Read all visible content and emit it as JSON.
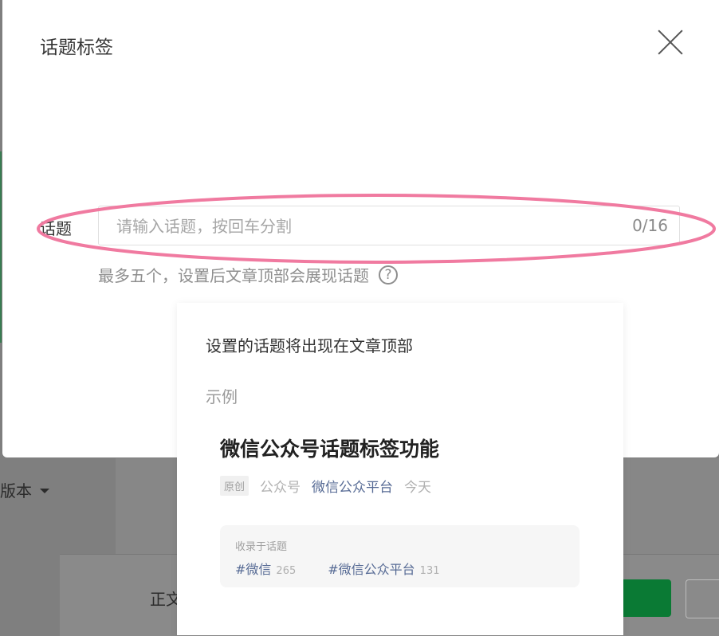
{
  "background": {
    "version_label": "版本",
    "zhengwen_label": "正文"
  },
  "modal": {
    "title": "话题标签",
    "field": {
      "label": "话题",
      "placeholder": "请输入话题，按回车分割",
      "value": "",
      "counter": "0/16"
    },
    "hint": "最多五个，设置后文章顶部会展现话题",
    "help_icon_glyph": "?"
  },
  "popover": {
    "title": "设置的话题将出现在文章顶部",
    "example_label": "示例",
    "article_title": "微信公众号话题标签功能",
    "meta": {
      "badge": "原创",
      "account_type": "公众号",
      "account_name": "微信公众平台",
      "date": "今天"
    },
    "topic_box": {
      "label": "收录于话题",
      "tags": [
        {
          "name": "#微信",
          "count": "265"
        },
        {
          "name": "#微信公众平台",
          "count": "131"
        }
      ]
    }
  },
  "colors": {
    "link_blue": "#576b95",
    "annotation_pink": "#f07aa0",
    "primary_green": "#0a7a34"
  }
}
